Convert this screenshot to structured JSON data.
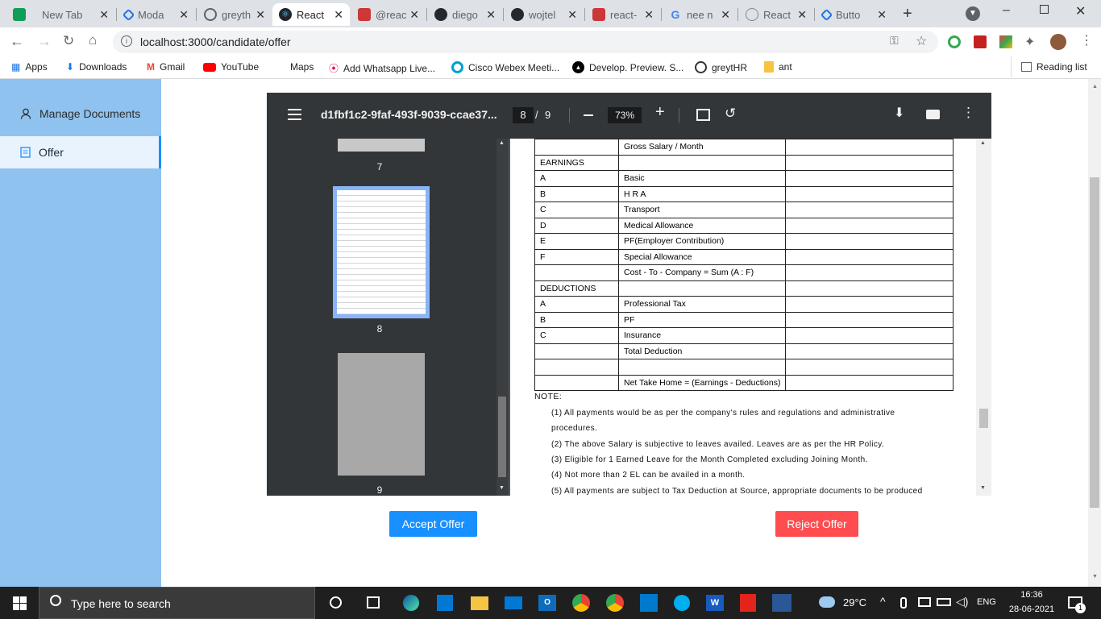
{
  "browser": {
    "tabs": [
      {
        "label": "New Tab",
        "icon": "sheets-icon"
      },
      {
        "label": "Moda",
        "icon": "react-icon"
      },
      {
        "label": "greyth",
        "icon": "globe-icon"
      },
      {
        "label": "React",
        "icon": "react-icon"
      },
      {
        "label": "@reac",
        "icon": "npm-icon"
      },
      {
        "label": "diego",
        "icon": "github-icon"
      },
      {
        "label": "wojtel",
        "icon": "github-icon"
      },
      {
        "label": "react-",
        "icon": "npm-icon"
      },
      {
        "label": "nee n",
        "icon": "google-icon"
      },
      {
        "label": "React",
        "icon": "react-icon"
      },
      {
        "label": "Butto",
        "icon": "react-icon"
      }
    ],
    "url": "localhost:3000/candidate/offer",
    "bookmarks": [
      "Apps",
      "Downloads",
      "Gmail",
      "YouTube",
      "Maps",
      "Add Whatsapp Live...",
      "Cisco Webex Meeti...",
      "Develop. Preview. S...",
      "greytHR",
      "ant"
    ],
    "reading_list": "Reading list"
  },
  "sidebar": {
    "items": [
      {
        "label": "Manage Documents",
        "icon": "user-icon"
      },
      {
        "label": "Offer",
        "icon": "document-icon"
      }
    ]
  },
  "pdf": {
    "filename": "d1fbf1c2-9faf-493f-9039-ccae37...",
    "current_page": "8",
    "page_sep": "/",
    "total_pages": "9",
    "zoom": "73%",
    "thumb_labels": [
      "7",
      "8",
      "9"
    ],
    "table": {
      "rows": [
        [
          "",
          "Gross Salary / Month",
          ""
        ],
        [
          "EARNINGS",
          "",
          ""
        ],
        [
          "A",
          "Basic",
          ""
        ],
        [
          "B",
          "H R A",
          ""
        ],
        [
          "C",
          "Transport",
          ""
        ],
        [
          "D",
          "Medical Allowance",
          ""
        ],
        [
          "E",
          "PF(Employer Contribution)",
          ""
        ],
        [
          "F",
          "Special Allowance",
          ""
        ],
        [
          "",
          "Cost - To - Company = Sum (A : F)",
          ""
        ],
        [
          "DEDUCTIONS",
          "",
          ""
        ],
        [
          "A",
          "Professional Tax",
          ""
        ],
        [
          "B",
          "PF",
          ""
        ],
        [
          "C",
          "Insurance",
          ""
        ],
        [
          "",
          "Total Deduction",
          ""
        ],
        [
          "",
          "",
          ""
        ],
        [
          "",
          "Net Take Home = (Earnings - Deductions)",
          ""
        ]
      ]
    },
    "note_title": "NOTE:",
    "notes": [
      "(1) All payments would be as per the company's rules and regulations and administrative",
      "procedures.",
      "(2) The above Salary is subjective to leaves availed. Leaves are as per the HR Policy.",
      "(3) Eligible for 1 Earned Leave for the Month Completed excluding Joining Month.",
      "(4) Not more than 2 EL can be availed in a month.",
      "(5) All payments are subject to Tax Deduction at Source, appropriate documents to be produced"
    ]
  },
  "actions": {
    "accept": "Accept Offer",
    "reject": "Reject Offer"
  },
  "colors": {
    "accept": "#1890ff",
    "reject": "#ff4d4f",
    "sidebar": "#8fc2ee"
  },
  "taskbar": {
    "search_placeholder": "Type here to search",
    "temperature": "29°C",
    "language": "ENG",
    "time": "16:36",
    "date": "28-06-2021",
    "notification_count": "1"
  }
}
